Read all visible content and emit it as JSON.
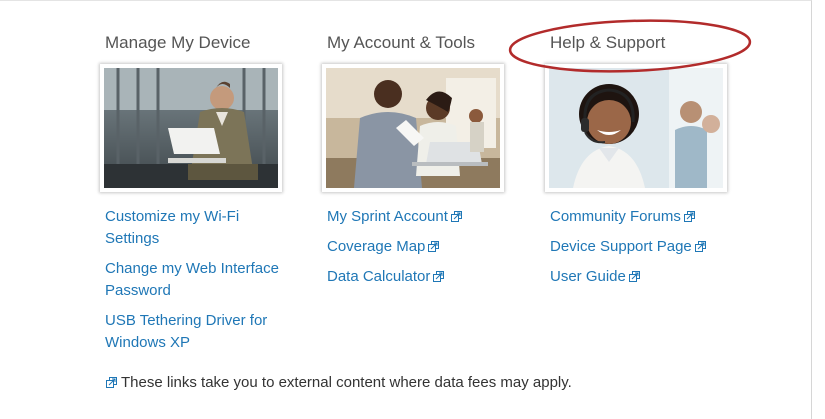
{
  "columns": [
    {
      "title": "Manage My Device",
      "image": "man-with-laptop-photo",
      "links": [
        {
          "label": "Customize my Wi-Fi Settings",
          "external": false
        },
        {
          "label": "Change my Web Interface Password",
          "external": false
        },
        {
          "label": "USB Tethering Driver for Windows XP",
          "external": false
        }
      ]
    },
    {
      "title": "My Account & Tools",
      "image": "people-at-laptop-photo",
      "links": [
        {
          "label": "My Sprint Account",
          "external": true
        },
        {
          "label": "Coverage Map",
          "external": true
        },
        {
          "label": "Data Calculator",
          "external": true
        }
      ]
    },
    {
      "title": "Help & Support",
      "image": "support-agent-headset-photo",
      "links": [
        {
          "label": "Community Forums",
          "external": true
        },
        {
          "label": "Device Support Page",
          "external": true
        },
        {
          "label": "User Guide",
          "external": true
        }
      ]
    }
  ],
  "footnote": "These links take you to external content where data fees may apply.",
  "colors": {
    "link": "#1f77b6",
    "title": "#555555",
    "annotation": "#b22b2b"
  }
}
